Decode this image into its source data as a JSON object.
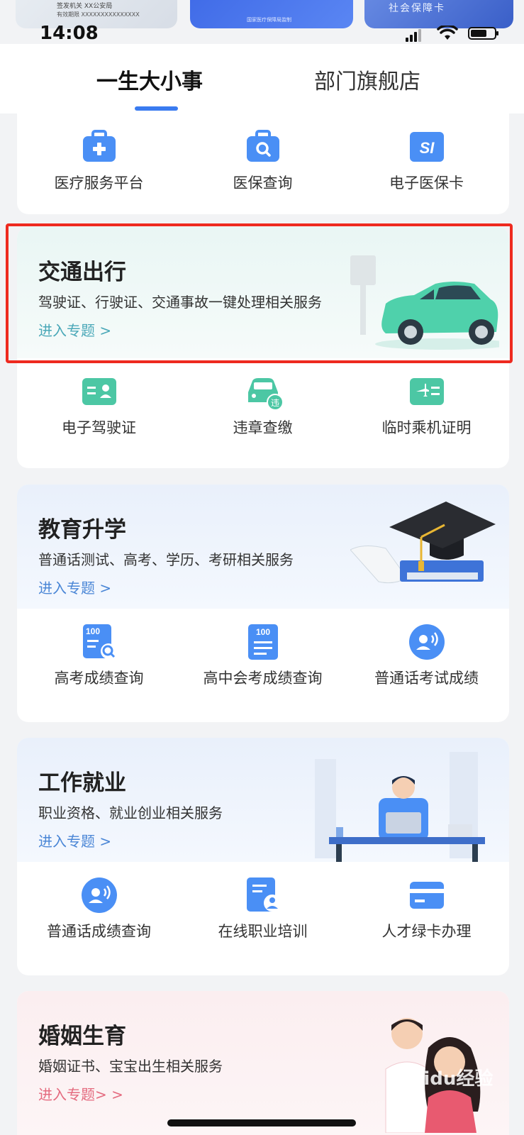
{
  "peek_cards": {
    "card1_line1": "签发机关  XX公安局",
    "card1_line2": "有效期限  XXXXXXXXXXXXXXX",
    "card2_text": "国家医疗保障局监制",
    "card3_text": "社会保障卡"
  },
  "status_bar": {
    "time": "14:08"
  },
  "tabs": [
    {
      "label": "一生大小事",
      "active": true
    },
    {
      "label": "部门旗舰店",
      "active": false
    }
  ],
  "medical": {
    "items": [
      {
        "label": "医疗服务平台",
        "icon": "medical-kit-icon"
      },
      {
        "label": "医保查询",
        "icon": "briefcase-search-icon"
      },
      {
        "label": "电子医保卡",
        "icon": "si-card-icon"
      }
    ]
  },
  "traffic": {
    "title": "交通出行",
    "subtitle": "驾驶证、行驶证、交通事故一键处理相关服务",
    "link": "进入专题 >",
    "items": [
      {
        "label": "电子驾驶证",
        "icon": "driver-license-icon"
      },
      {
        "label": "违章查缴",
        "icon": "car-violation-icon",
        "badge": "违"
      },
      {
        "label": "临时乘机证明",
        "icon": "flight-pass-icon"
      }
    ]
  },
  "education": {
    "title": "教育升学",
    "subtitle": "普通话测试、高考、学历、考研相关服务",
    "link": "进入专题 >",
    "items": [
      {
        "label": "高考成绩查询",
        "icon": "score-search-icon",
        "badge": "100"
      },
      {
        "label": "高中会考成绩查询",
        "icon": "score-doc-icon",
        "badge": "100"
      },
      {
        "label": "普通话考试成绩",
        "icon": "speech-icon"
      }
    ]
  },
  "work": {
    "title": "工作就业",
    "subtitle": "职业资格、就业创业相关服务",
    "link": "进入专题 >",
    "items": [
      {
        "label": "普通话成绩查询",
        "icon": "speech-icon"
      },
      {
        "label": "在线职业培训",
        "icon": "training-icon"
      },
      {
        "label": "人才绿卡办理",
        "icon": "card-icon"
      }
    ]
  },
  "marriage": {
    "title": "婚姻生育",
    "subtitle": "婚姻证书、宝宝出生相关服务",
    "link": "进入专题> >"
  },
  "watermark": "Baidu经验",
  "colors": {
    "accent": "#3a7bf0",
    "teal": "#4cc7a4",
    "highlight": "#ee2a1f"
  }
}
